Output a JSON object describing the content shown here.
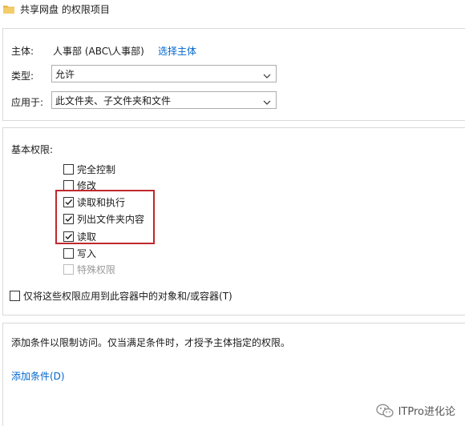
{
  "window": {
    "title": "共享网盘 的权限项目"
  },
  "principal": {
    "label": "主体:",
    "value": "人事部 (ABC\\人事部)",
    "select_link": "选择主体"
  },
  "type": {
    "label": "类型:",
    "selected": "允许"
  },
  "applies_to": {
    "label": "应用于:",
    "selected": "此文件夹、子文件夹和文件"
  },
  "basic_permissions": {
    "label": "基本权限:",
    "items": [
      {
        "label": "完全控制",
        "checked": false,
        "enabled": true
      },
      {
        "label": "修改",
        "checked": false,
        "enabled": true
      },
      {
        "label": "读取和执行",
        "checked": true,
        "enabled": true
      },
      {
        "label": "列出文件夹内容",
        "checked": true,
        "enabled": true
      },
      {
        "label": "读取",
        "checked": true,
        "enabled": true
      },
      {
        "label": "写入",
        "checked": false,
        "enabled": true
      },
      {
        "label": "特殊权限",
        "checked": false,
        "enabled": false
      }
    ],
    "apply_to_children": {
      "label": "仅将这些权限应用到此容器中的对象和/或容器(T)",
      "checked": false
    }
  },
  "conditions": {
    "description": "添加条件以限制访问。仅当满足条件时，才授予主体指定的权限。",
    "add_link": "添加条件(D)"
  },
  "watermark": {
    "text": "ITPro进化论"
  },
  "colors": {
    "link": "#0066cc",
    "highlight": "#c0282d",
    "folder": "#e8b84a"
  }
}
